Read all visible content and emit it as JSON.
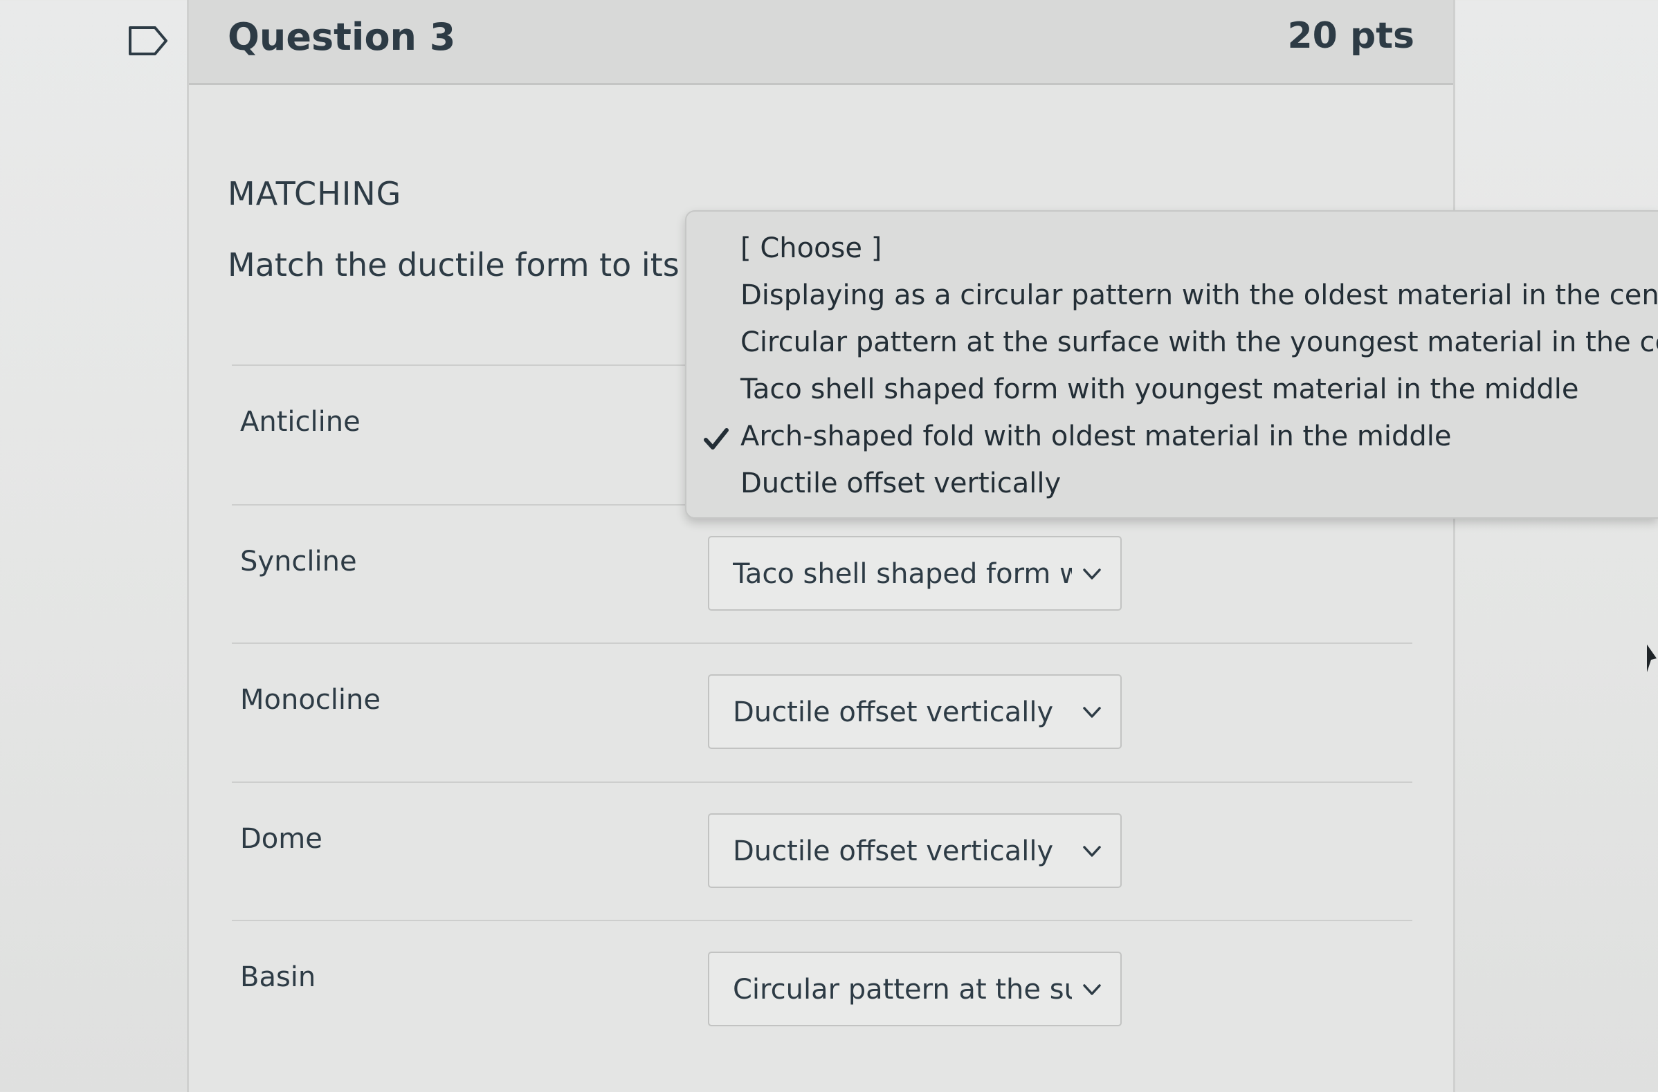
{
  "question": {
    "title": "Question 3",
    "points": "20 pts",
    "type_heading": "MATCHING",
    "prompt": "Match the ductile form to its cor"
  },
  "rows": [
    {
      "label": "Anticline",
      "selected": ""
    },
    {
      "label": "Syncline",
      "selected": "Taco shell shaped form with"
    },
    {
      "label": "Monocline",
      "selected": "Ductile offset vertically"
    },
    {
      "label": "Dome",
      "selected": "Ductile offset vertically"
    },
    {
      "label": "Basin",
      "selected": "Circular pattern at the surfa"
    }
  ],
  "dropdown": {
    "options": [
      "[ Choose ]",
      "Displaying as a circular pattern with the oldest material in the center",
      "Circular pattern at the surface with the youngest material in the center",
      "Taco shell shaped form with youngest material in the middle",
      "Arch-shaped fold with oldest material in the middle",
      "Ductile offset vertically"
    ],
    "checked_option": "Arch-shaped fold with oldest material in the middle"
  },
  "colors": {
    "text": "#2d3b45",
    "background": "#e5e6e5",
    "header": "#d8d9d8",
    "dropdown": "#dbdcdb"
  },
  "icons": {
    "bookmark": "flag-icon",
    "select_arrow": "chevron-down-icon",
    "selected_mark": "checkmark-icon",
    "pointer": "cursor-icon"
  }
}
